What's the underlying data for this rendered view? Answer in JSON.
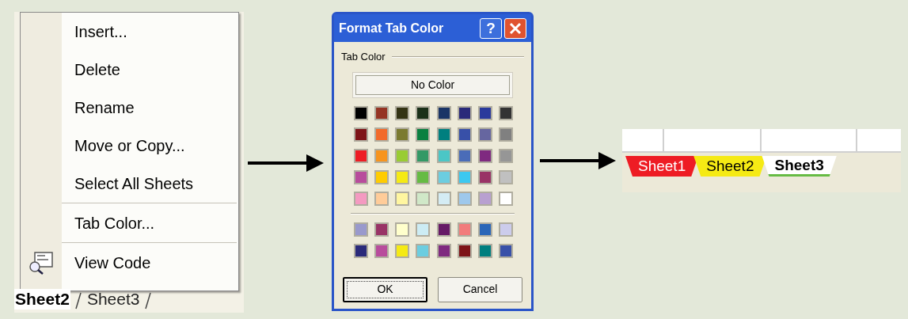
{
  "context_menu": {
    "items": [
      {
        "kind": "item",
        "label": "Insert...",
        "icon": false
      },
      {
        "kind": "item",
        "label": "Delete",
        "icon": false
      },
      {
        "kind": "item",
        "label": "Rename",
        "icon": false
      },
      {
        "kind": "item",
        "label": "Move or Copy...",
        "icon": false
      },
      {
        "kind": "item",
        "label": "Select All Sheets",
        "icon": false
      },
      {
        "kind": "separator"
      },
      {
        "kind": "item",
        "label": "Tab Color...",
        "icon": false
      },
      {
        "kind": "separator"
      },
      {
        "kind": "item",
        "label": "View Code",
        "icon": true
      }
    ]
  },
  "left_tabs": [
    {
      "label": "Sheet2",
      "selected": true
    },
    {
      "label": "Sheet3",
      "selected": false
    }
  ],
  "dialog": {
    "title": "Format Tab Color",
    "help_button": "?",
    "group_label": "Tab Color",
    "no_color_button": "No Color",
    "palette": [
      {
        "color": "#000000"
      },
      {
        "color": "#953424"
      },
      {
        "color": "#333314"
      },
      {
        "color": "#1a3018"
      },
      {
        "color": "#1a3566"
      },
      {
        "color": "#2a2a7a"
      },
      {
        "color": "#2a3a9c"
      },
      {
        "color": "#333333"
      },
      {
        "color": "#7e1418"
      },
      {
        "color": "#f26a2a"
      },
      {
        "color": "#7a7a30"
      },
      {
        "color": "#0a8040"
      },
      {
        "color": "#007f7f"
      },
      {
        "color": "#3850a8"
      },
      {
        "color": "#6666a0"
      },
      {
        "color": "#808080"
      },
      {
        "color": "#ee1c24"
      },
      {
        "color": "#f7941d"
      },
      {
        "color": "#99cc33"
      },
      {
        "color": "#339966"
      },
      {
        "color": "#4bc6c6"
      },
      {
        "color": "#4a6cb8"
      },
      {
        "color": "#7f2a80"
      },
      {
        "color": "#969696"
      },
      {
        "color": "#b84c9c"
      },
      {
        "color": "#ffcc00"
      },
      {
        "color": "#f5ea14"
      },
      {
        "color": "#66bb44"
      },
      {
        "color": "#6ccde0"
      },
      {
        "color": "#3cc8f0"
      },
      {
        "color": "#993366"
      },
      {
        "color": "#c0c0c0"
      },
      {
        "color": "#f49ac1"
      },
      {
        "color": "#ffcc99"
      },
      {
        "color": "#fff6a0"
      },
      {
        "color": "#d0e8c8"
      },
      {
        "color": "#d4ecf4"
      },
      {
        "color": "#9ec8ec"
      },
      {
        "color": "#b8a0d0"
      },
      {
        "color": "#ffffff"
      }
    ],
    "custom_palette": [
      {
        "color": "#9999cc"
      },
      {
        "color": "#993366"
      },
      {
        "color": "#ffffcc"
      },
      {
        "color": "#ccecf4"
      },
      {
        "color": "#661a66"
      },
      {
        "color": "#f27c7c"
      },
      {
        "color": "#2a66b8"
      },
      {
        "color": "#ccccec"
      },
      {
        "color": "#2a2a7a"
      },
      {
        "color": "#b84c9c"
      },
      {
        "color": "#f5ea14"
      },
      {
        "color": "#6ccde0"
      },
      {
        "color": "#7f2a80"
      },
      {
        "color": "#7e1418"
      },
      {
        "color": "#007f7f"
      },
      {
        "color": "#3850a8"
      }
    ],
    "buttons": [
      {
        "label": "OK",
        "focused": true
      },
      {
        "label": "Cancel",
        "focused": false
      }
    ]
  },
  "result_tabs": [
    {
      "label": "Sheet1",
      "color": "#ee1c24",
      "selected": false
    },
    {
      "label": "Sheet2",
      "color": "#f5ea14",
      "selected": false
    },
    {
      "label": "Sheet3",
      "color": "#66bb44",
      "selected": true
    }
  ]
}
